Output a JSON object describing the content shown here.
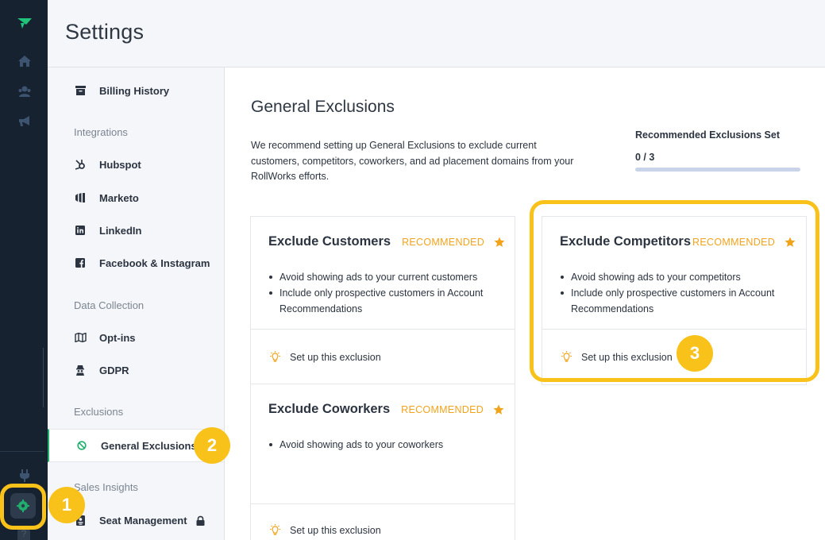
{
  "header": {
    "title": "Settings"
  },
  "sidebar": {
    "items": [
      {
        "label": "Billing History",
        "icon": "archive-box-icon"
      },
      {
        "label": "Hubspot",
        "icon": "hubspot-icon"
      },
      {
        "label": "Marketo",
        "icon": "marketo-icon"
      },
      {
        "label": "LinkedIn",
        "icon": "linkedin-icon"
      },
      {
        "label": "Facebook & Instagram",
        "icon": "facebook-icon"
      },
      {
        "label": "Opt-ins",
        "icon": "map-icon"
      },
      {
        "label": "GDPR",
        "icon": "gdpr-icon"
      },
      {
        "label": "General Exclusions",
        "icon": "prohibited-icon"
      },
      {
        "label": "Seat Management",
        "icon": "id-badge-icon"
      }
    ],
    "sections": {
      "integrations": "Integrations",
      "data_collection": "Data Collection",
      "exclusions": "Exclusions",
      "sales_insights": "Sales Insights"
    }
  },
  "main": {
    "title": "General Exclusions",
    "description": "We recommend setting up General Exclusions to exclude current customers, competitors, coworkers, and ad placement domains from your RollWorks efforts.",
    "progress": {
      "title": "Recommended Exclusions Set",
      "count": "0 / 3",
      "fraction": 0
    },
    "cards": [
      {
        "title": "Exclude Customers",
        "badge": "RECOMMENDED",
        "bullets": [
          "Avoid showing ads to your current customers",
          "Include only prospective customers in Account Recommendations"
        ],
        "action": "Set up this exclusion"
      },
      {
        "title": "Exclude Competitors",
        "badge": "RECOMMENDED",
        "bullets": [
          "Avoid showing ads to your competitors",
          "Include only prospective customers in Account Recommendations"
        ],
        "action": "Set up this exclusion"
      },
      {
        "title": "Exclude Coworkers",
        "badge": "RECOMMENDED",
        "bullets": [
          "Avoid showing ads to your coworkers"
        ],
        "action": "Set up this exclusion"
      }
    ]
  },
  "steps": [
    "1",
    "2",
    "3"
  ],
  "colors": {
    "accent": "#f2a31c",
    "highlight": "#f8c21a",
    "brand_green": "#1fae6b",
    "rail": "#172230"
  }
}
